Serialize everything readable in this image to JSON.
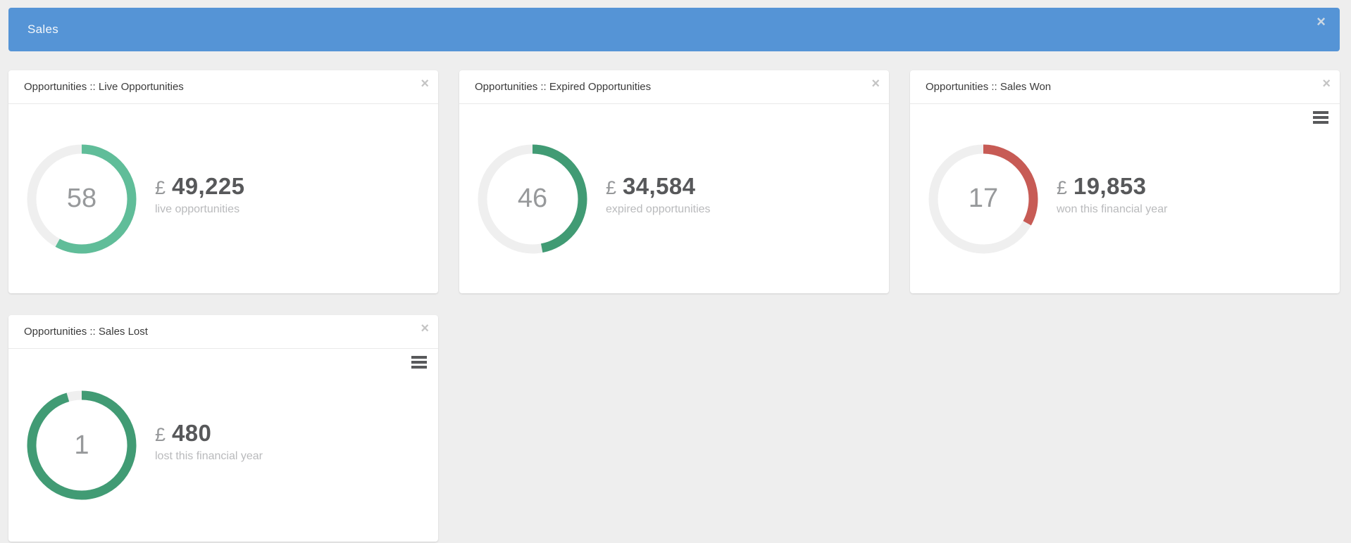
{
  "header": {
    "title": "Sales",
    "background": "#5594d6"
  },
  "icons": {
    "close": "×",
    "menu": "hamburger-menu"
  },
  "cards": [
    {
      "title": "Opportunities :: Live Opportunities",
      "gauge": {
        "count": "58",
        "percent": 58,
        "color": "#60bd99",
        "track": "#efefef"
      },
      "currency": "£",
      "amount": "49,225",
      "label": "live opportunities"
    },
    {
      "title": "Opportunities :: Expired Opportunities",
      "gauge": {
        "count": "46",
        "percent": 47,
        "color": "#419b74",
        "track": "#efefef"
      },
      "currency": "£",
      "amount": "34,584",
      "label": "expired opportunities"
    },
    {
      "title": "Opportunities :: Sales Won",
      "gauge": {
        "count": "17",
        "percent": 33,
        "color": "#c75b55",
        "track": "#efefef"
      },
      "currency": "£",
      "amount": "19,853",
      "label": "won this financial year"
    },
    {
      "title": "Opportunities :: Sales Lost",
      "gauge": {
        "count": "1",
        "percent": 95.5,
        "color": "#419b74",
        "track": "#efefef"
      },
      "currency": "£",
      "amount": "480",
      "label": "lost this financial year"
    }
  ],
  "chart_data": [
    {
      "type": "pie",
      "variant": "donut-gauge",
      "title": "Opportunities :: Live Opportunities",
      "center_value": 58,
      "arc_percent": 58,
      "arc_color": "#60bd99",
      "amount": "£ 49,225",
      "caption": "live opportunities"
    },
    {
      "type": "pie",
      "variant": "donut-gauge",
      "title": "Opportunities :: Expired Opportunities",
      "center_value": 46,
      "arc_percent": 47,
      "arc_color": "#419b74",
      "amount": "£ 34,584",
      "caption": "expired opportunities"
    },
    {
      "type": "pie",
      "variant": "donut-gauge",
      "title": "Opportunities :: Sales Won",
      "center_value": 17,
      "arc_percent": 33,
      "arc_color": "#c75b55",
      "amount": "£ 19,853",
      "caption": "won this financial year"
    },
    {
      "type": "pie",
      "variant": "donut-gauge",
      "title": "Opportunities :: Sales Lost",
      "center_value": 1,
      "arc_percent": 95.5,
      "arc_color": "#419b74",
      "amount": "£ 480",
      "caption": "lost this financial year"
    }
  ]
}
